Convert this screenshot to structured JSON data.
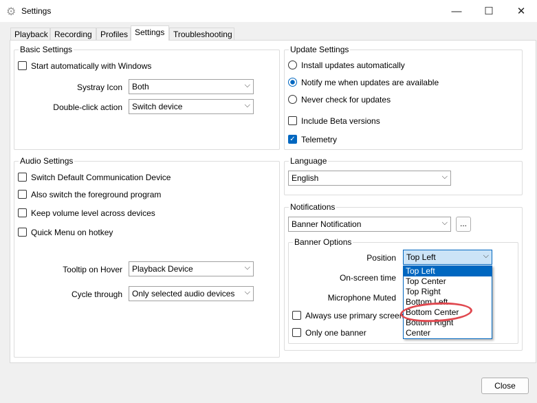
{
  "window": {
    "title": "Settings",
    "minimize": "—",
    "maximize": "☐",
    "close": "✕"
  },
  "tabs": [
    "Playback",
    "Recording",
    "Profiles",
    "Settings",
    "Troubleshooting"
  ],
  "basic": {
    "title": "Basic Settings",
    "start_auto": "Start automatically with Windows",
    "systray_label": "Systray Icon",
    "systray_value": "Both",
    "dblclick_label": "Double-click action",
    "dblclick_value": "Switch device"
  },
  "audio": {
    "title": "Audio Settings",
    "opt1": "Switch Default Communication Device",
    "opt2": "Also switch the foreground program",
    "opt3": "Keep volume level across devices",
    "opt4": "Quick Menu on hotkey",
    "tooltip_label": "Tooltip on Hover",
    "tooltip_value": "Playback Device",
    "cycle_label": "Cycle through",
    "cycle_value": "Only selected audio devices"
  },
  "update": {
    "title": "Update Settings",
    "r1": "Install updates automatically",
    "r2": "Notify me when updates are available",
    "r3": "Never check for updates",
    "beta": "Include Beta versions",
    "telemetry": "Telemetry"
  },
  "language": {
    "title": "Language",
    "value": "English"
  },
  "notifications": {
    "title": "Notifications",
    "value": "Banner Notification",
    "more": "...",
    "banner": {
      "title": "Banner Options",
      "position_label": "Position",
      "position_value": "Top Left",
      "onscreen_label": "On-screen time",
      "mic_label": "Microphone Muted",
      "primary": "Always use primary screen",
      "one": "Only one banner",
      "options": [
        "Top Left",
        "Top Center",
        "Top Right",
        "Bottom Left",
        "Bottom Center",
        "Bottom Right",
        "Center"
      ]
    }
  },
  "close_button": "Close",
  "colors": {
    "accent": "#0067c0",
    "annotation": "#e0484f"
  }
}
